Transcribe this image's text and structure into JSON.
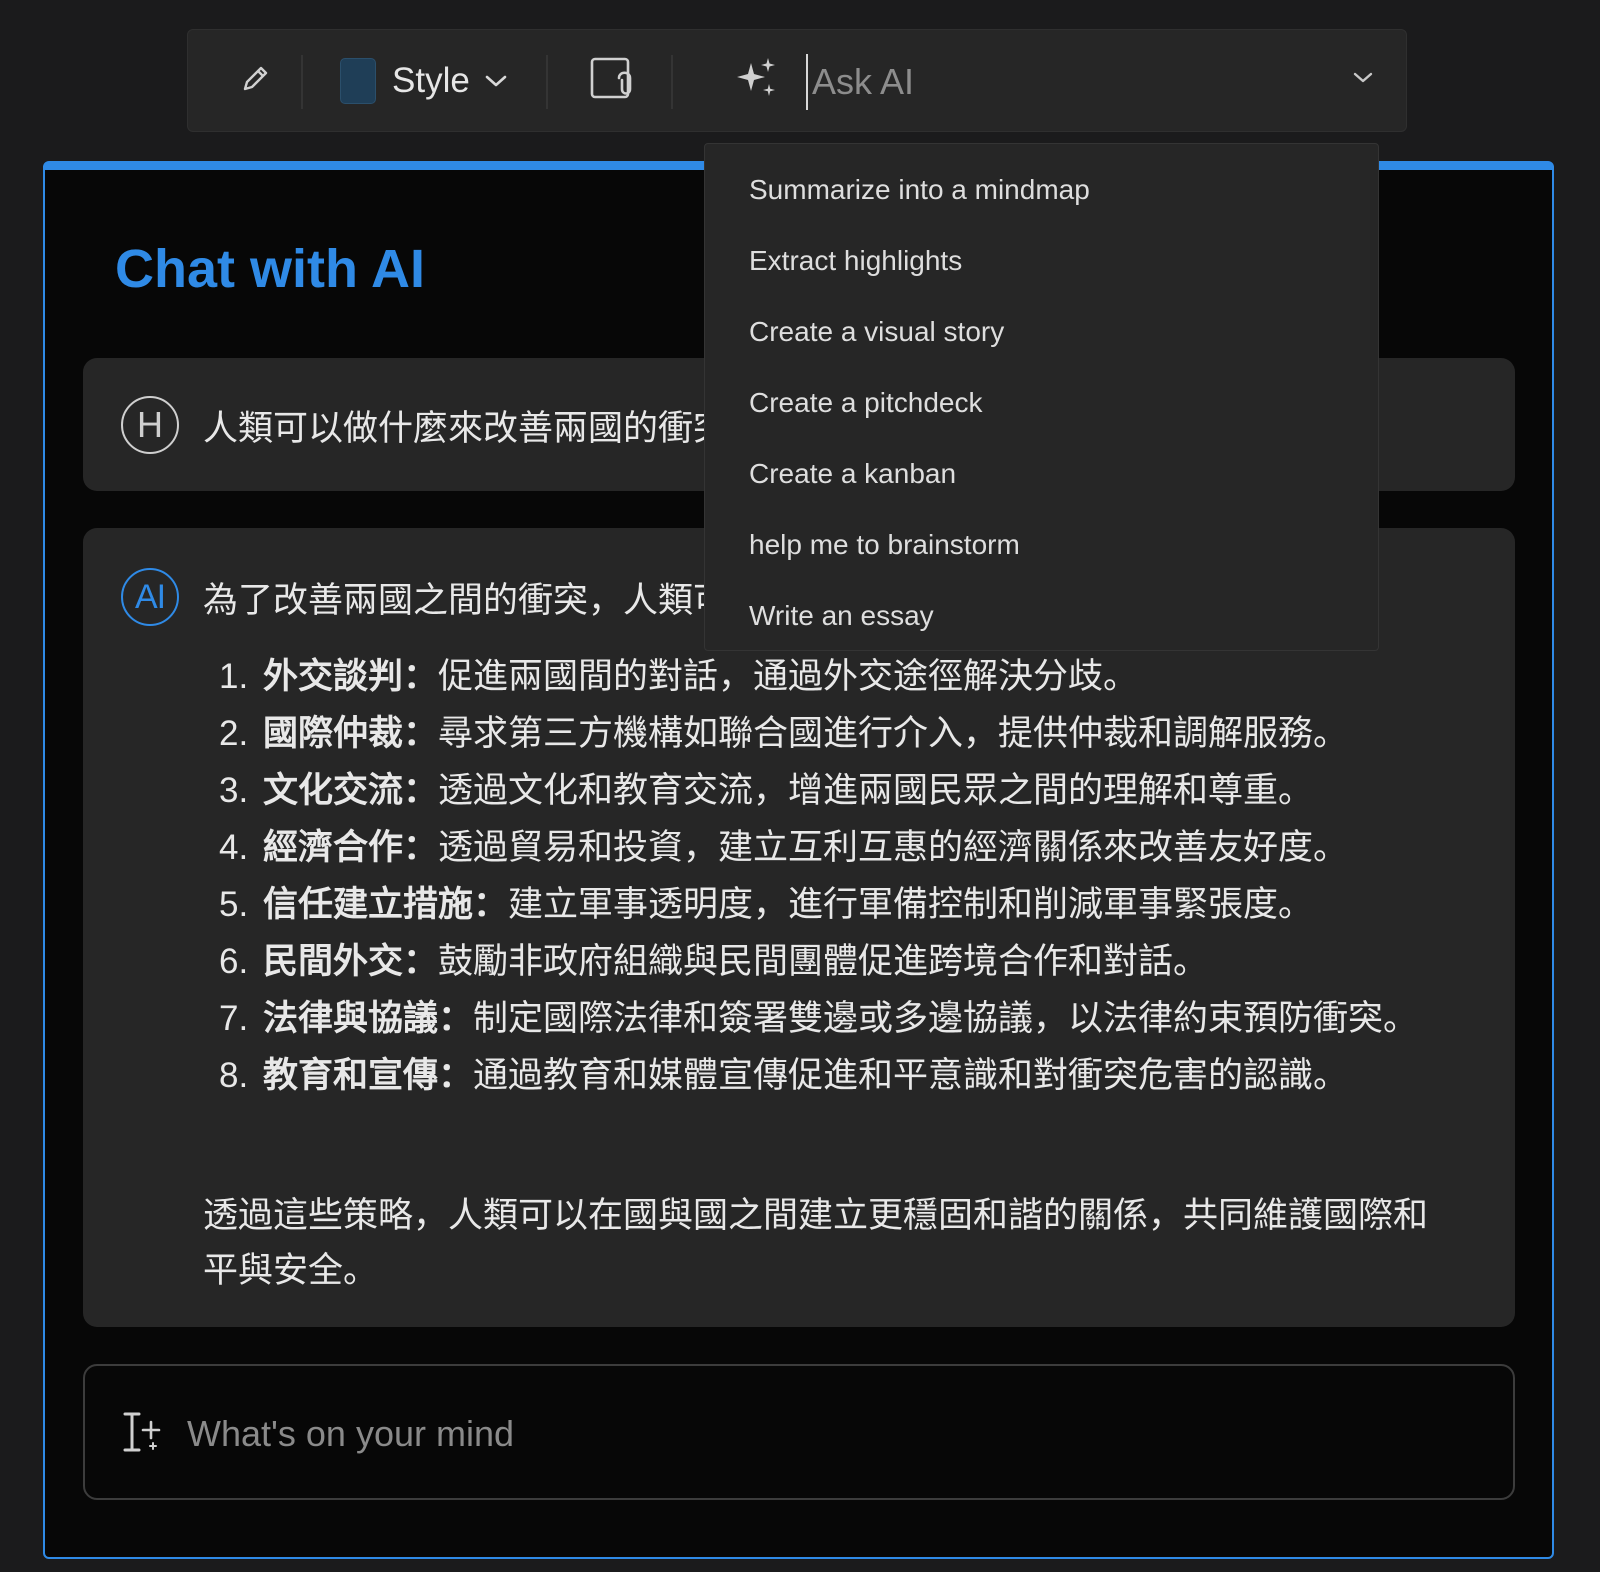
{
  "toolbar": {
    "style_label": "Style",
    "ask_placeholder": "Ask AI",
    "style_swatch_color": "#1f3e57",
    "icons": [
      "pencil-icon",
      "chevron-down-icon",
      "reference-icon",
      "sparkles-icon",
      "chevron-down-icon"
    ]
  },
  "panel": {
    "title": "Chat with AI",
    "accent_color": "#2f8ae6"
  },
  "user_message": {
    "avatar": "H",
    "text": "人類可以做什麼來改善兩國的衝突？"
  },
  "ai_message": {
    "avatar": "AI",
    "intro": "為了改善兩國之間的衝突，人類可以採取以下策略：",
    "items": [
      {
        "num": "1.",
        "head": "外交談判：",
        "body": "促進兩國間的對話，通過外交途徑解決分歧。"
      },
      {
        "num": "2.",
        "head": "國際仲裁：",
        "body": "尋求第三方機構如聯合國進行介入，提供仲裁和調解服務。"
      },
      {
        "num": "3.",
        "head": "文化交流：",
        "body": "透過文化和教育交流，增進兩國民眾之間的理解和尊重。"
      },
      {
        "num": "4.",
        "head": "經濟合作：",
        "body": "透過貿易和投資，建立互利互惠的經濟關係來改善友好度。"
      },
      {
        "num": "5.",
        "head": "信任建立措施：",
        "body": "建立軍事透明度，進行軍備控制和削減軍事緊張度。"
      },
      {
        "num": "6.",
        "head": "民間外交：",
        "body": "鼓勵非政府組織與民間團體促進跨境合作和對話。"
      },
      {
        "num": "7.",
        "head": "法律與協議：",
        "body": "制定國際法律和簽署雙邊或多邊協議，以法律約束預防衝突。"
      },
      {
        "num": "8.",
        "head": "教育和宣傳：",
        "body": "通過教育和媒體宣傳促進和平意識和對衝突危害的認識。"
      }
    ],
    "outro": "透過這些策略，人類可以在國與國之間建立更穩固和諧的關係，共同維護國際和平與安全。"
  },
  "composer": {
    "placeholder": "What's on your mind",
    "icon": "text-cursor-sparkle-icon"
  },
  "dropdown": {
    "items": [
      "Summarize into a mindmap",
      "Extract highlights",
      "Create a visual story",
      "Create a pitchdeck",
      "Create a kanban",
      "help me to brainstorm",
      "Write an essay"
    ]
  }
}
